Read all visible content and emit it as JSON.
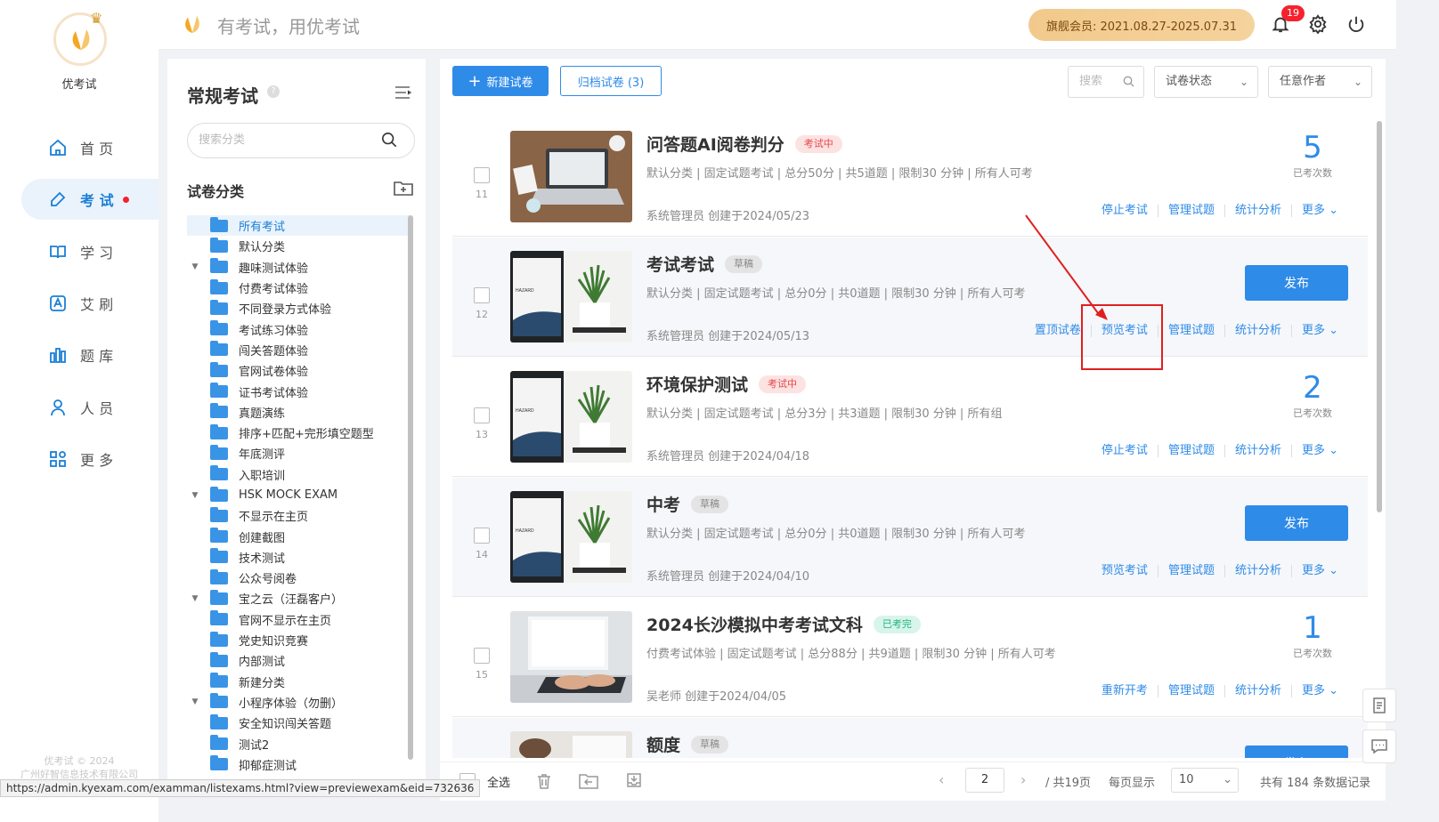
{
  "app": {
    "name": "优考试",
    "slogan": "有考试，用优考试",
    "copyright_line1": "优考试 © 2024",
    "copyright_line2": "广州好智信息技术有限公司"
  },
  "nav": {
    "items": [
      {
        "label": "首 页",
        "icon": "home-icon"
      },
      {
        "label": "考 试",
        "icon": "exam-icon",
        "active": true
      },
      {
        "label": "学 习",
        "icon": "book-icon"
      },
      {
        "label": "艾 刷",
        "icon": "a-icon"
      },
      {
        "label": "题 库",
        "icon": "bank-icon"
      },
      {
        "label": "人 员",
        "icon": "user-icon"
      },
      {
        "label": "更 多",
        "icon": "apps-icon"
      }
    ]
  },
  "header": {
    "vip_label": "旗舰会员:  2021.08.27-2025.07.31",
    "notifications": "19"
  },
  "category": {
    "title": "常规考试",
    "search_placeholder": "搜索分类",
    "tree_title": "试卷分类",
    "items": [
      {
        "label": "所有考试",
        "selected": true
      },
      {
        "label": "默认分类"
      },
      {
        "label": "趣味测试体验",
        "expand": true
      },
      {
        "label": "付费考试体验"
      },
      {
        "label": "不同登录方式体验"
      },
      {
        "label": "考试练习体验"
      },
      {
        "label": "闯关答题体验"
      },
      {
        "label": "官网试卷体验"
      },
      {
        "label": "证书考试体验"
      },
      {
        "label": "真题演练"
      },
      {
        "label": "排序+匹配+完形填空题型"
      },
      {
        "label": "年底测评"
      },
      {
        "label": "入职培训"
      },
      {
        "label": "HSK MOCK EXAM",
        "expand": true
      },
      {
        "label": "不显示在主页"
      },
      {
        "label": "创建截图"
      },
      {
        "label": "技术测试"
      },
      {
        "label": "公众号阅卷"
      },
      {
        "label": "宝之云（汪磊客户）",
        "expand": true
      },
      {
        "label": "官网不显示在主页"
      },
      {
        "label": "党史知识竞赛"
      },
      {
        "label": "内部测试"
      },
      {
        "label": "新建分类"
      },
      {
        "label": "小程序体验（勿删）",
        "expand": true
      },
      {
        "label": "安全知识闯关答题"
      },
      {
        "label": "测试2"
      },
      {
        "label": "抑郁症测试"
      }
    ]
  },
  "toolbar": {
    "new_label": "新建试卷",
    "archive_label": "归档试卷 (3)",
    "search_placeholder": "搜索",
    "status_select": "试卷状态",
    "author_select": "任意作者"
  },
  "exams": [
    {
      "num": "11",
      "title": "问答题AI阅卷判分",
      "tag": "考试中",
      "tag_type": "run",
      "meta": "默认分类 | 固定试题考试 | 总分50分 | 共5道题 | 限制30 分钟 | 所有人可考",
      "creator": "系统管理员 创建于2024/05/23",
      "count": "5",
      "count_label": "已考次数",
      "actions": [
        "停止考试",
        "管理试题",
        "统计分析",
        "更多 ⌄"
      ],
      "thumb": "laptop-desk"
    },
    {
      "num": "12",
      "title": "考试考试",
      "tag": "草稿",
      "tag_type": "draft",
      "meta": "默认分类 | 固定试题考试 | 总分0分 | 共0道题 | 限制30 分钟 | 所有人可考",
      "creator": "系统管理员 创建于2024/05/13",
      "publish": "发布",
      "actions": [
        "置顶试卷",
        "预览考试",
        "管理试题",
        "统计分析",
        "更多 ⌄"
      ],
      "thumb": "plant"
    },
    {
      "num": "13",
      "title": "环境保护测试",
      "tag": "考试中",
      "tag_type": "run",
      "meta": "默认分类 | 固定试题考试 | 总分3分 | 共3道题 | 限制30 分钟 | 所有组",
      "creator": "系统管理员 创建于2024/04/18",
      "count": "2",
      "count_label": "已考次数",
      "actions": [
        "停止考试",
        "管理试题",
        "统计分析",
        "更多 ⌄"
      ],
      "thumb": "plant"
    },
    {
      "num": "14",
      "title": "中考",
      "tag": "草稿",
      "tag_type": "draft",
      "meta": "默认分类 | 固定试题考试 | 总分0分 | 共0道题 | 限制30 分钟 | 所有人可考",
      "creator": "系统管理员 创建于2024/04/10",
      "publish": "发布",
      "actions": [
        "预览考试",
        "管理试题",
        "统计分析",
        "更多 ⌄"
      ],
      "thumb": "plant"
    },
    {
      "num": "15",
      "title": "2024长沙模拟中考考试文科",
      "tag": "已考完",
      "tag_type": "done",
      "meta": "付费考试体验 | 固定试题考试 | 总分88分 | 共9道题 | 限制30 分钟 | 所有人可考",
      "creator": "吴老师 创建于2024/04/05",
      "count": "1",
      "count_label": "已考次数",
      "actions": [
        "重新开考",
        "管理试题",
        "统计分析",
        "更多 ⌄"
      ],
      "thumb": "typing"
    },
    {
      "num": "16",
      "title": "额度",
      "tag": "草稿",
      "tag_type": "draft",
      "meta": "",
      "creator": "",
      "publish": "发布",
      "actions": [],
      "thumb": "desk"
    }
  ],
  "footer": {
    "select_all": "全选",
    "page": "2",
    "total_pages": "/ 共19页",
    "per_page_label": "每页显示",
    "per_page": "10",
    "total_records": "共有 184 条数据记录"
  },
  "status_url": "https://admin.kyexam.com/examman/listexams.html?view=previewexam&eid=732636",
  "colors": {
    "primary": "#2f8be8",
    "highlight": "#e02020"
  }
}
